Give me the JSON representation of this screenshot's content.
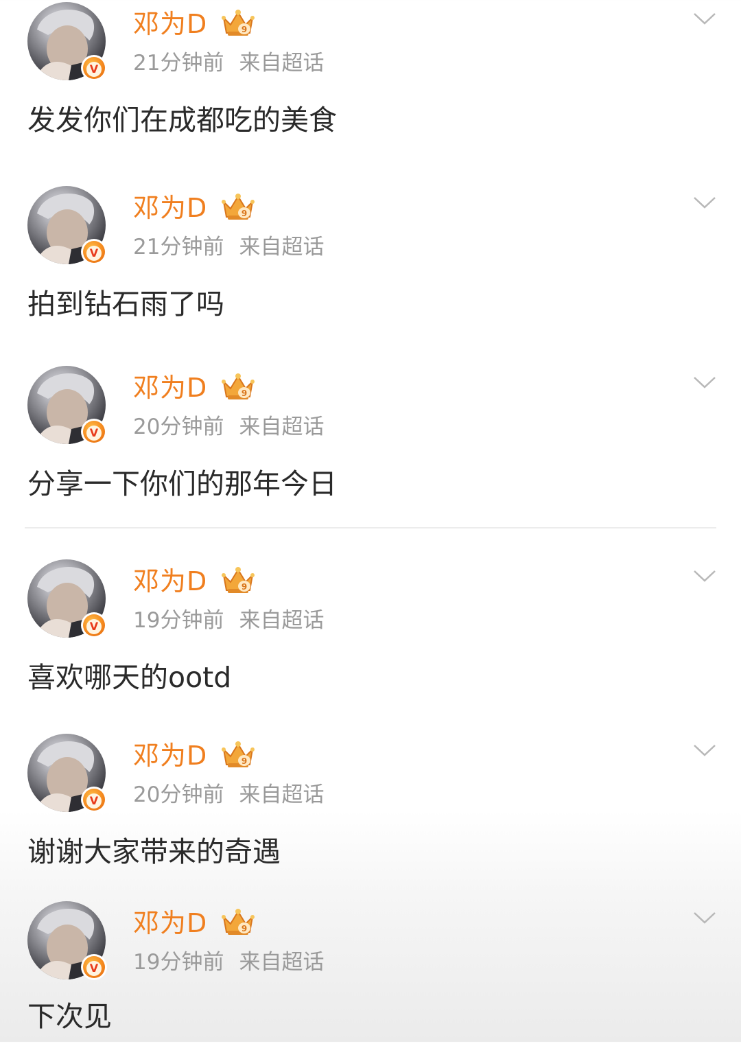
{
  "posts": [
    {
      "username": "邓为D",
      "time": "21分钟前",
      "source": "来自超话",
      "content": "发发你们在成都吃的美食",
      "badge": "V"
    },
    {
      "username": "邓为D",
      "time": "21分钟前",
      "source": "来自超话",
      "content": "拍到钻石雨了吗",
      "badge": "V"
    },
    {
      "username": "邓为D",
      "time": "20分钟前",
      "source": "来自超话",
      "content": "分享一下你们的那年今日",
      "badge": "V"
    },
    {
      "username": "邓为D",
      "time": "19分钟前",
      "source": "来自超话",
      "content": "喜欢哪天的ootd",
      "badge": "V"
    },
    {
      "username": "邓为D",
      "time": "20分钟前",
      "source": "来自超话",
      "content": "谢谢大家带来的奇遇",
      "badge": "V"
    },
    {
      "username": "邓为D",
      "time": "19分钟前",
      "source": "来自超话",
      "content": "下次见",
      "badge": "V"
    }
  ],
  "icons": {
    "avatar": "avatar-photo",
    "verified": "verified-badge-icon",
    "crown": "crown-level-icon",
    "menu": "chevron-down-icon"
  },
  "colors": {
    "username": "#f07f1f",
    "meta": "#9a9a9a",
    "content": "#2a2a2a",
    "badge": "#f58a1f"
  }
}
